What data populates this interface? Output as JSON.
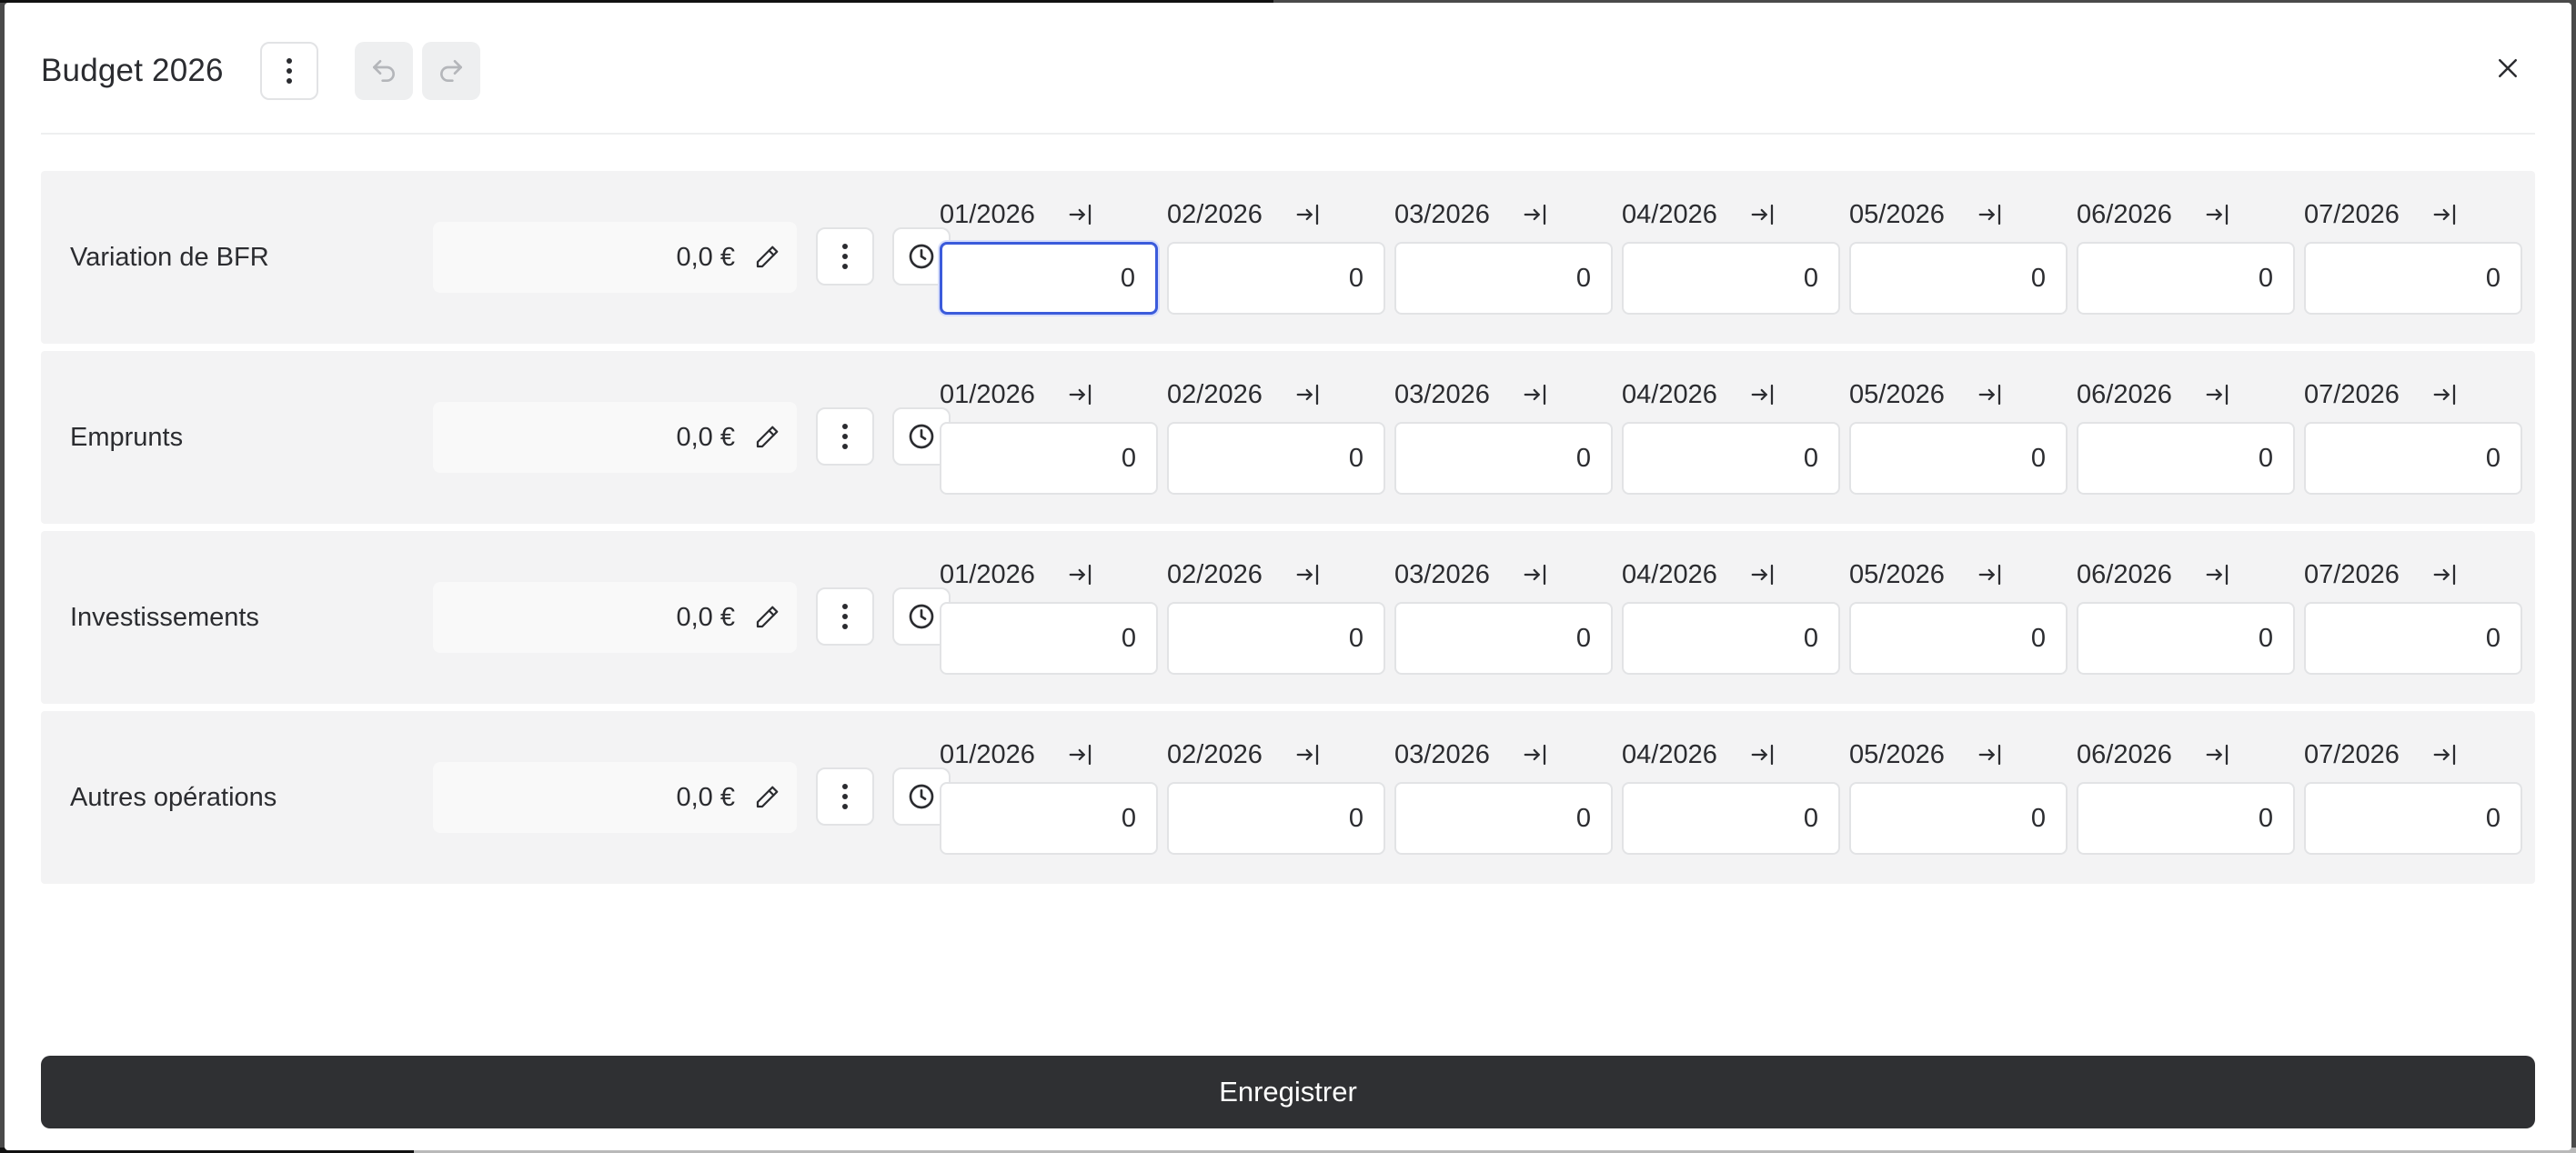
{
  "modal": {
    "title": "Budget 2026",
    "close_icon": "close-icon",
    "save_label": "Enregistrer"
  },
  "months": [
    "01/2026",
    "02/2026",
    "03/2026",
    "04/2026",
    "05/2026",
    "06/2026",
    "07/2026"
  ],
  "rows": [
    {
      "label": "Variation de BFR",
      "total": "0,0 €",
      "values": [
        "0",
        "0",
        "0",
        "0",
        "0",
        "0",
        "0"
      ]
    },
    {
      "label": "Emprunts",
      "total": "0,0 €",
      "values": [
        "0",
        "0",
        "0",
        "0",
        "0",
        "0",
        "0"
      ]
    },
    {
      "label": "Investissements",
      "total": "0,0 €",
      "values": [
        "0",
        "0",
        "0",
        "0",
        "0",
        "0",
        "0"
      ]
    },
    {
      "label": "Autres opérations",
      "total": "0,0 €",
      "values": [
        "0",
        "0",
        "0",
        "0",
        "0",
        "0",
        "0"
      ]
    }
  ],
  "colors": {
    "accent_focus": "#3b5bdb",
    "save_button": "#2f3033",
    "row_background": "#f3f3f4"
  }
}
